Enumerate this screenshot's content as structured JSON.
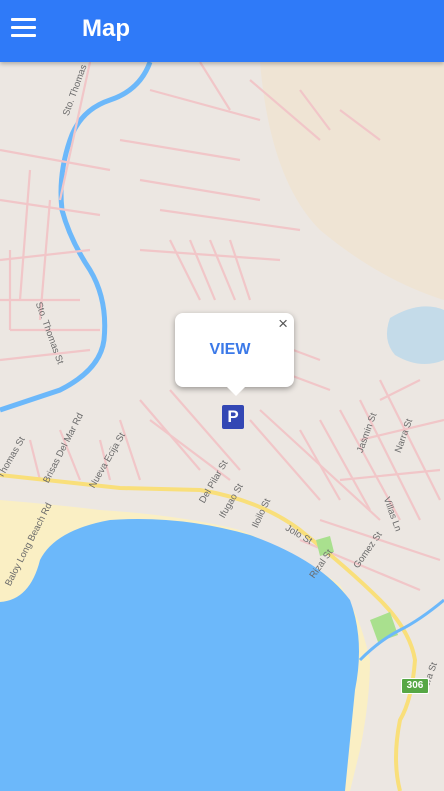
{
  "header": {
    "title": "Map",
    "menu_icon": "menu-icon"
  },
  "popup": {
    "action_label": "VIEW",
    "close_symbol": "×"
  },
  "marker": {
    "label": "P"
  },
  "route_shield": "306",
  "streets": [
    "Sto. Thomas",
    "Sto. Thomas St",
    "Thomas St",
    "Brisas Del Mar Rd",
    "Nueva Ecija St",
    "Baloy Long Beach Rd",
    "Del Pilar St",
    "Ifugao St",
    "Iloilo St",
    "Jolo St",
    "Rizal St",
    "Gomez St",
    "Villas Ln",
    "Jasmin St",
    "Narra St",
    "Abra St"
  ],
  "colors": {
    "appbar": "#2f7af8",
    "water": "#6cb8fa",
    "land": "#ece7e2",
    "beach": "#faefc4",
    "road_major": "#f9df7a",
    "road_minor": "#f1c6c8",
    "park": "#a9e08e",
    "marker": "#3347b4"
  }
}
